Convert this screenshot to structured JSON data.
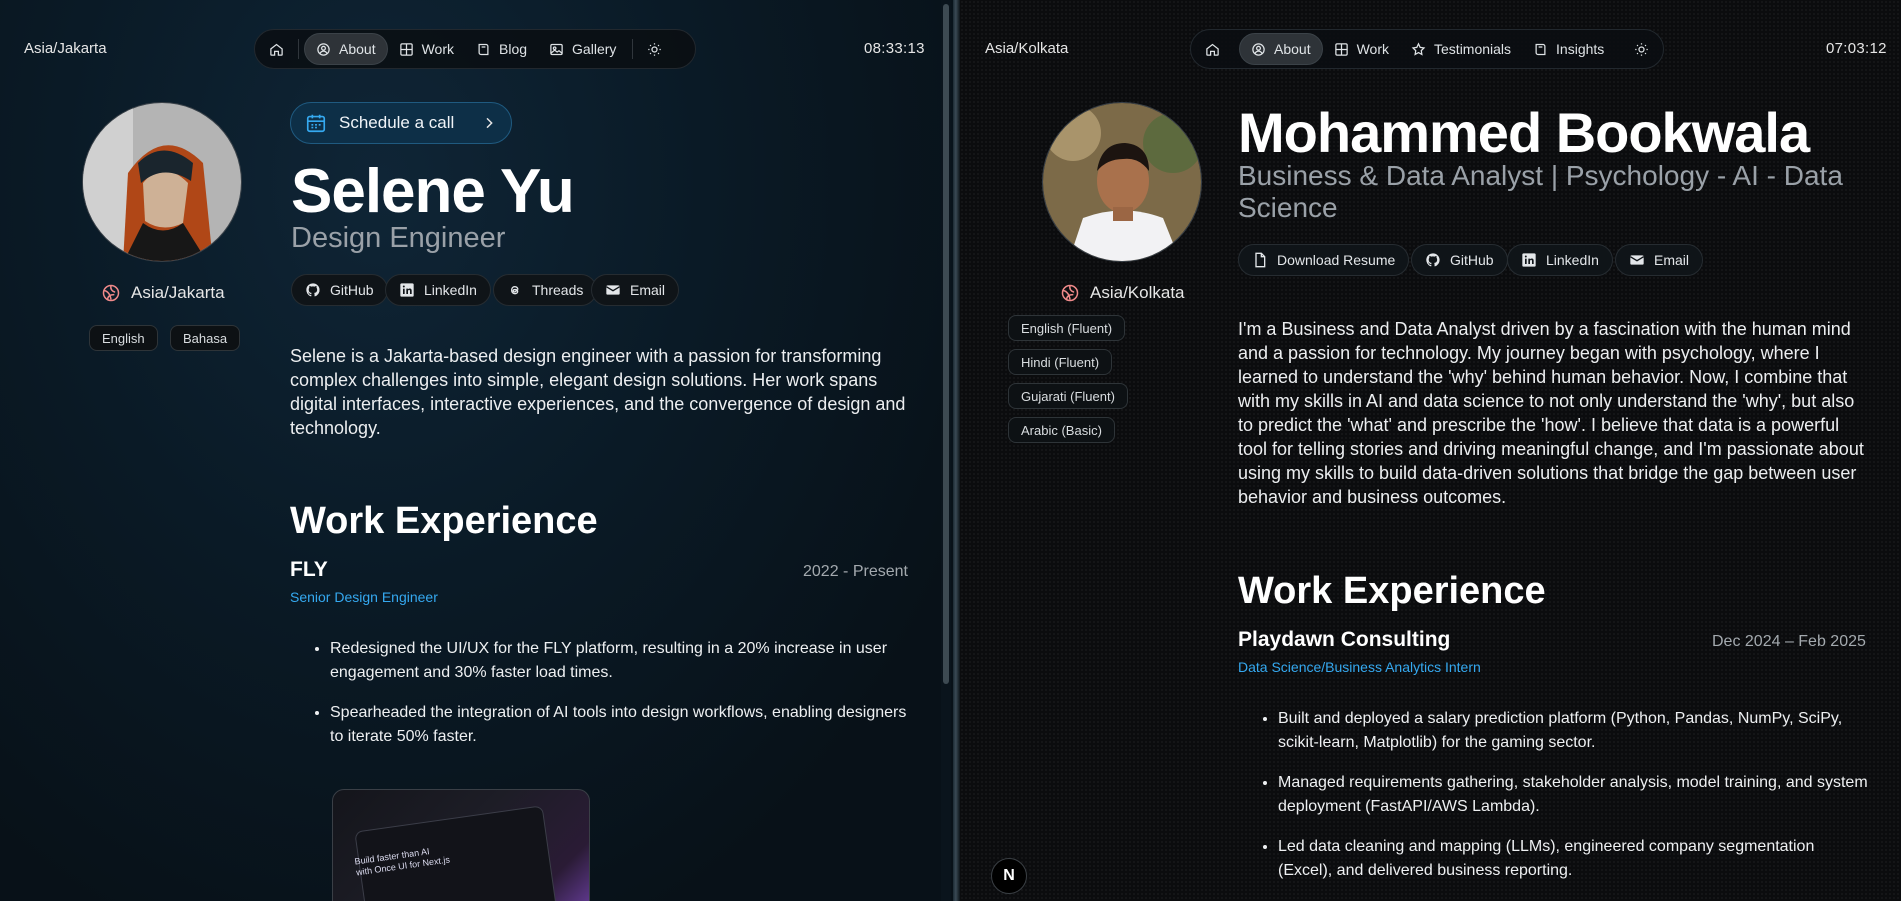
{
  "left": {
    "timezone": "Asia/Jakarta",
    "clock": "08:33:13",
    "nav": {
      "about": "About",
      "work": "Work",
      "blog": "Blog",
      "gallery": "Gallery"
    },
    "schedule_label": "Schedule a call",
    "name": "Selene Yu",
    "role": "Design Engineer",
    "location": "Asia/Jakarta",
    "languages": [
      "English",
      "Bahasa"
    ],
    "social": {
      "github": "GitHub",
      "linkedin": "LinkedIn",
      "threads": "Threads",
      "email": "Email"
    },
    "bio": "Selene is a Jakarta-based design engineer with a passion for transforming complex challenges into simple, elegant design solutions. Her work spans digital interfaces, interactive experiences, and the convergence of design and technology.",
    "work_heading": "Work Experience",
    "experience": {
      "company": "FLY",
      "period": "2022 - Present",
      "title": "Senior Design Engineer",
      "bullets": [
        "Redesigned the UI/UX for the FLY platform, resulting in a 20% increase in user engagement and 30% faster load times.",
        "Spearheaded the integration of AI tools into design workflows, enabling designers to iterate 50% faster."
      ],
      "preview_text": "Build faster than AI\nwith Once UI for Next.js"
    }
  },
  "right": {
    "timezone": "Asia/Kolkata",
    "clock": "07:03:12",
    "nav": {
      "about": "About",
      "work": "Work",
      "testimonials": "Testimonials",
      "insights": "Insights"
    },
    "name": "Mohammed Bookwala",
    "role": "Business & Data Analyst | Psychology - AI - Data Science",
    "location": "Asia/Kolkata",
    "languages": [
      "English (Fluent)",
      "Hindi (Fluent)",
      "Gujarati (Fluent)",
      "Arabic (Basic)"
    ],
    "social": {
      "resume": "Download Resume",
      "github": "GitHub",
      "linkedin": "LinkedIn",
      "email": "Email"
    },
    "bio": "I'm a Business and Data Analyst driven by a fascination with the human mind and a passion for technology. My journey began with psychology, where I learned to understand the 'why' behind human behavior. Now, I combine that with my skills in AI and data science to not only understand the 'why', but also to predict the 'what' and prescribe the 'how'. I believe that data is a powerful tool for telling stories and driving meaningful change, and I'm passionate about using my skills to build data-driven solutions that bridge the gap between user behavior and business outcomes.",
    "work_heading": "Work Experience",
    "experience": {
      "company": "Playdawn Consulting",
      "period": "Dec 2024 – Feb 2025",
      "title": "Data Science/Business Analytics Intern",
      "bullets": [
        "Built and deployed a salary prediction platform (Python, Pandas, NumPy, SciPy, scikit-learn, Matplotlib) for the gaming sector.",
        "Managed requirements gathering, stakeholder analysis, model training, and system deployment (FastAPI/AWS Lambda).",
        "Led data cleaning and mapping (LLMs), engineered company segmentation (Excel), and delivered business reporting."
      ]
    },
    "dev_badge": "N"
  },
  "colors": {
    "accent_blue": "#35a9f0",
    "schedule_bg": "#0d2f47"
  }
}
